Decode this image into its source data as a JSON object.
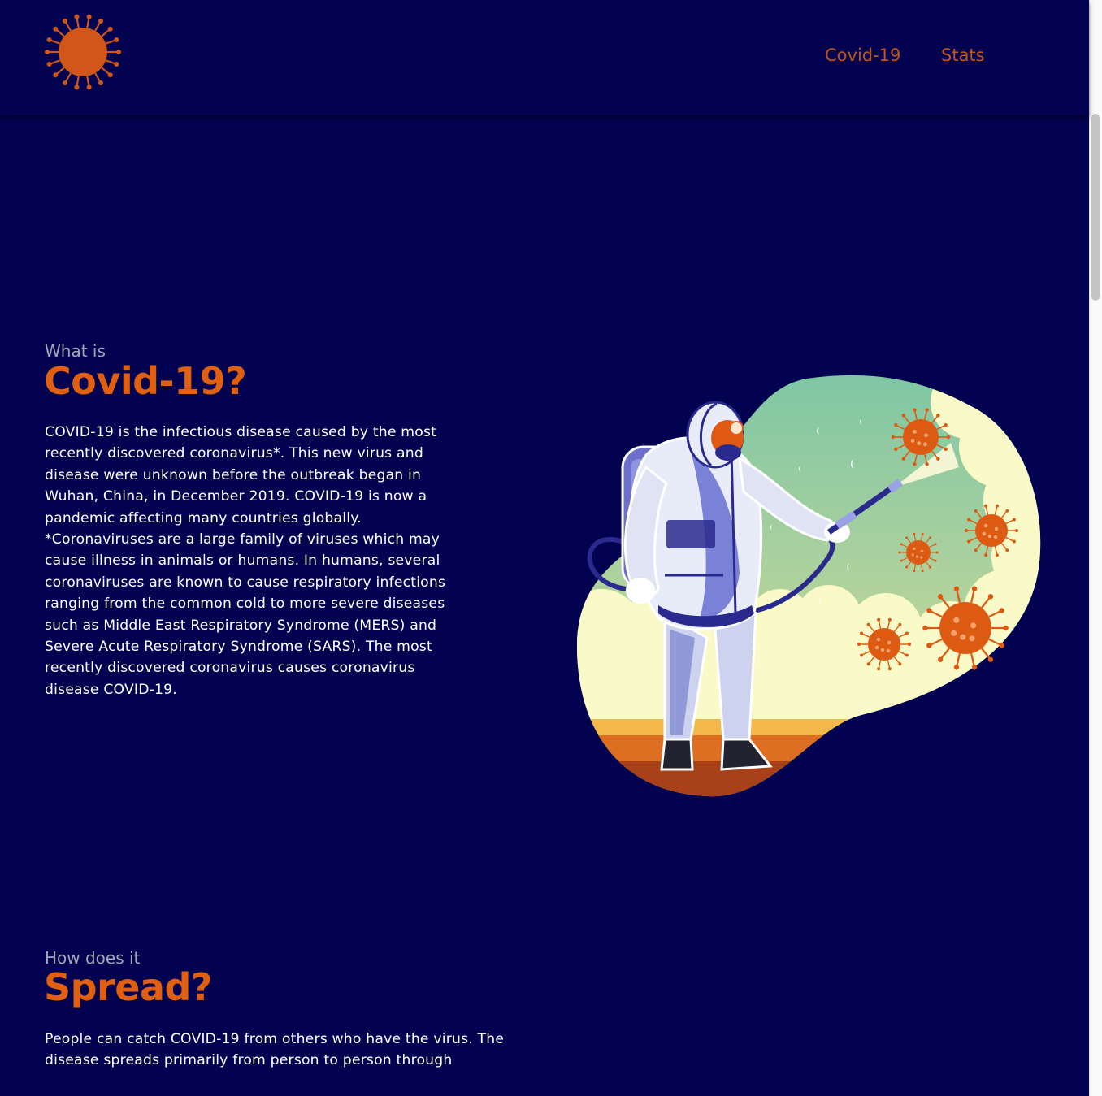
{
  "nav": {
    "logo_icon": "coronavirus-icon",
    "links": [
      {
        "label": "Covid-19"
      },
      {
        "label": "Stats"
      }
    ]
  },
  "sections": [
    {
      "kicker": "What is",
      "title": "Covid-19?",
      "body": "COVID-19 is the infectious disease caused by the most recently discovered coronavirus*. This new virus and disease were unknown before the outbreak began in Wuhan, China, in December 2019. COVID-19 is now a pandemic affecting many countries globally. *Coronaviruses are a large family of viruses which may cause illness in animals or humans. In humans, several coronaviruses are known to cause respiratory infections ranging from the common cold to more severe diseases such as Middle East Respiratory Syndrome (MERS) and Severe Acute Respiratory Syndrome (SARS). The most recently discovered coronavirus causes coronavirus disease COVID-19."
    },
    {
      "kicker": "How does it",
      "title": "Spread?",
      "body": "People can catch COVID-19 from others who have the virus. The disease spreads primarily from person to person through"
    }
  ],
  "colors": {
    "background": "#020250",
    "accent": "#e0600f",
    "nav_link": "#c4531a",
    "kicker": "#a6a6b8",
    "text": "#ffffff"
  }
}
